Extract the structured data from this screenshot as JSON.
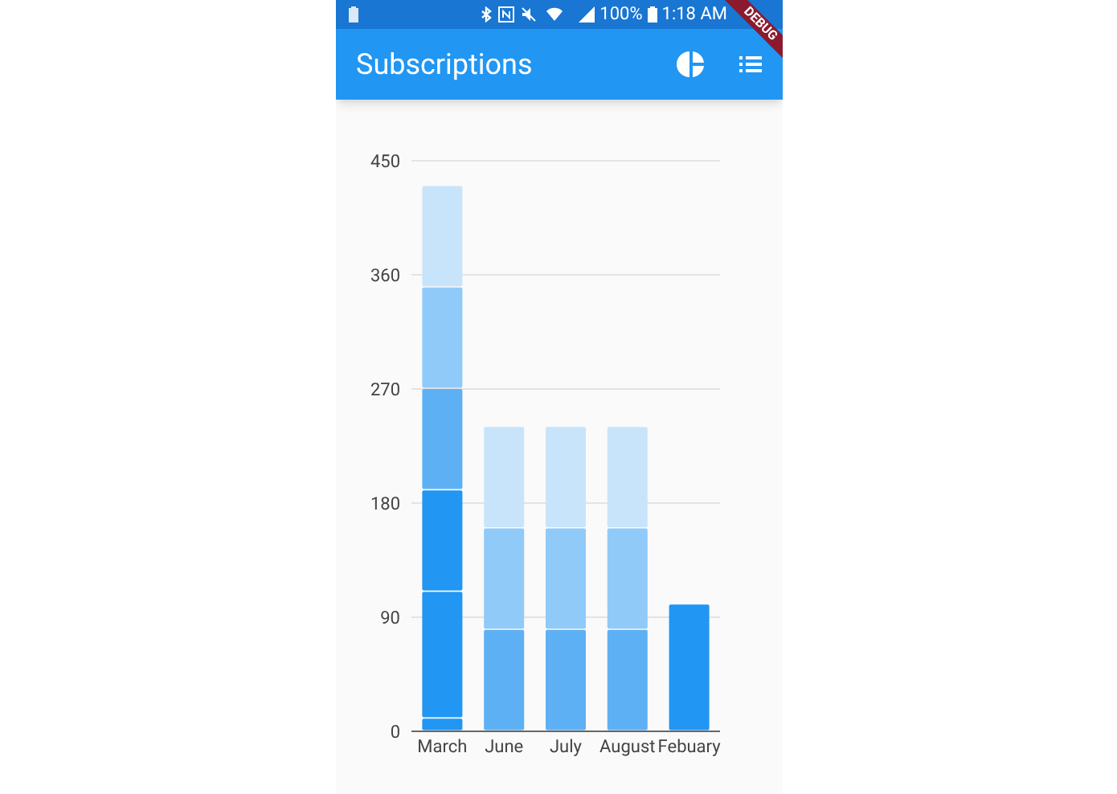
{
  "status_bar": {
    "battery": "100%",
    "time": "1:18 AM"
  },
  "debug_banner": "DEBUG",
  "app_bar": {
    "title": "Subscriptions"
  },
  "chart_data": {
    "type": "bar",
    "stacked": true,
    "grid": true,
    "categories": [
      "March",
      "June",
      "July",
      "August",
      "Febuary"
    ],
    "ylim": [
      0,
      450
    ],
    "yticks": [
      0,
      90,
      180,
      270,
      360,
      450
    ],
    "series": [
      {
        "color": "#2196f3",
        "values": [
          10,
          null,
          null,
          null,
          100
        ]
      },
      {
        "color": "#2196f3",
        "values": [
          100,
          null,
          null,
          null,
          null
        ]
      },
      {
        "color": "#2196f3",
        "values": [
          80,
          null,
          null,
          null,
          null
        ]
      },
      {
        "color": "#5eb0f5",
        "values": [
          80,
          80,
          80,
          80,
          null
        ]
      },
      {
        "color": "#90caf9",
        "values": [
          80,
          80,
          80,
          80,
          null
        ]
      },
      {
        "color": "#c8e4fb",
        "values": [
          80,
          80,
          80,
          80,
          null
        ]
      }
    ]
  }
}
